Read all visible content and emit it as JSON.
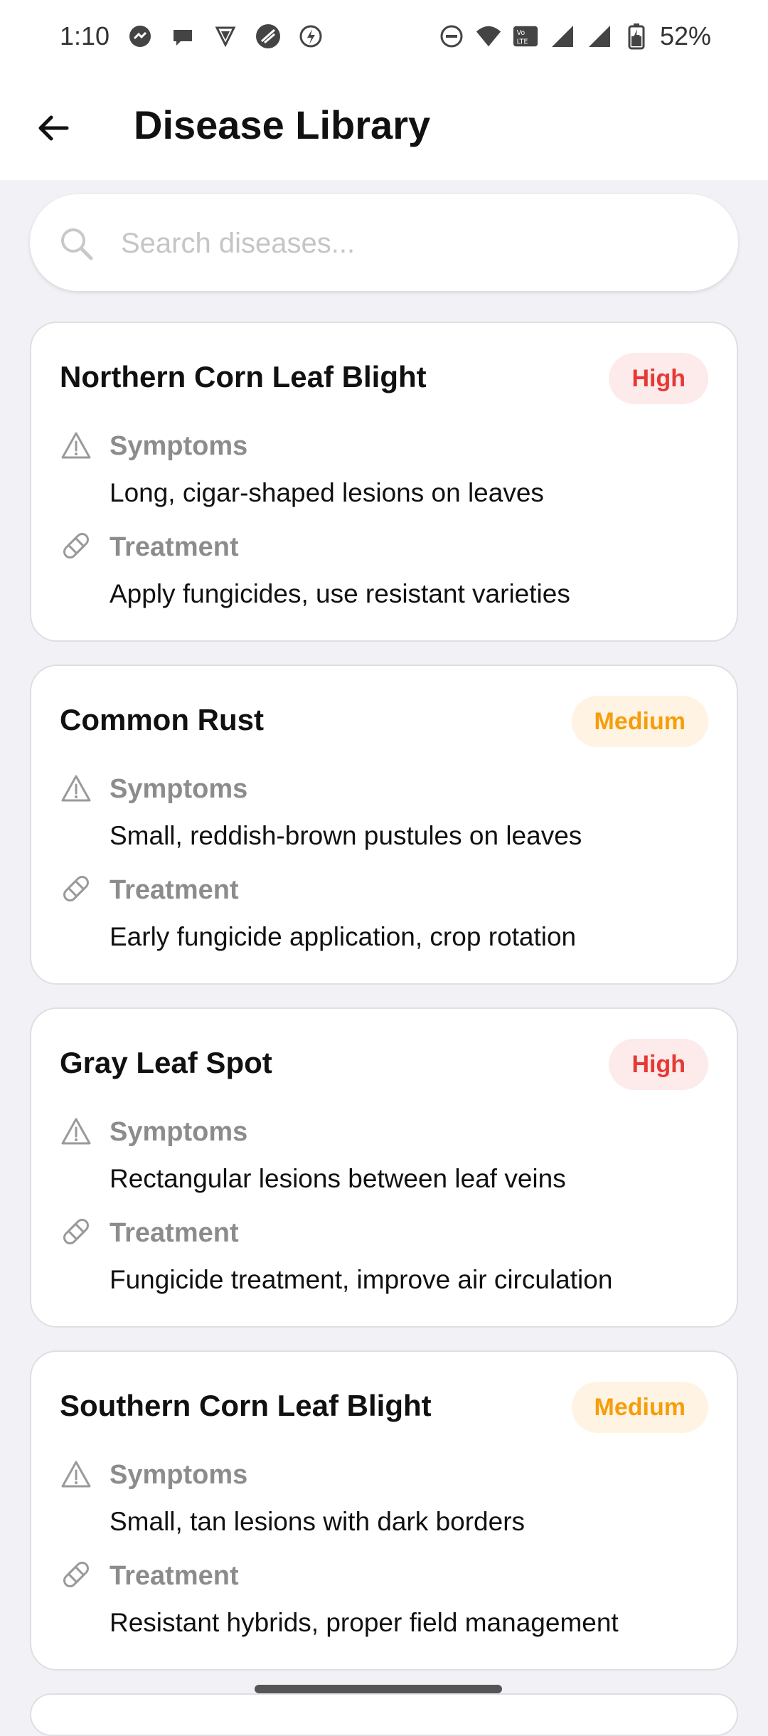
{
  "status_bar": {
    "time": "1:10",
    "battery": "52%"
  },
  "app_bar": {
    "title": "Disease Library"
  },
  "search": {
    "placeholder": "Search diseases..."
  },
  "labels": {
    "symptoms": "Symptoms",
    "treatment": "Treatment"
  },
  "colors": {
    "high_text": "#e53935",
    "high_bg": "#fdeaea",
    "medium_text": "#f59e0b",
    "medium_bg": "#fff3e3"
  },
  "diseases": [
    {
      "name": "Northern Corn Leaf Blight",
      "severity": "High",
      "symptoms": "Long, cigar-shaped lesions on leaves",
      "treatment": "Apply fungicides, use resistant varieties"
    },
    {
      "name": "Common Rust",
      "severity": "Medium",
      "symptoms": "Small, reddish-brown pustules on leaves",
      "treatment": "Early fungicide application, crop rotation"
    },
    {
      "name": "Gray Leaf Spot",
      "severity": "High",
      "symptoms": "Rectangular lesions between leaf veins",
      "treatment": "Fungicide treatment, improve air circulation"
    },
    {
      "name": "Southern Corn Leaf Blight",
      "severity": "Medium",
      "symptoms": "Small, tan lesions with dark borders",
      "treatment": "Resistant hybrids, proper field management"
    }
  ]
}
